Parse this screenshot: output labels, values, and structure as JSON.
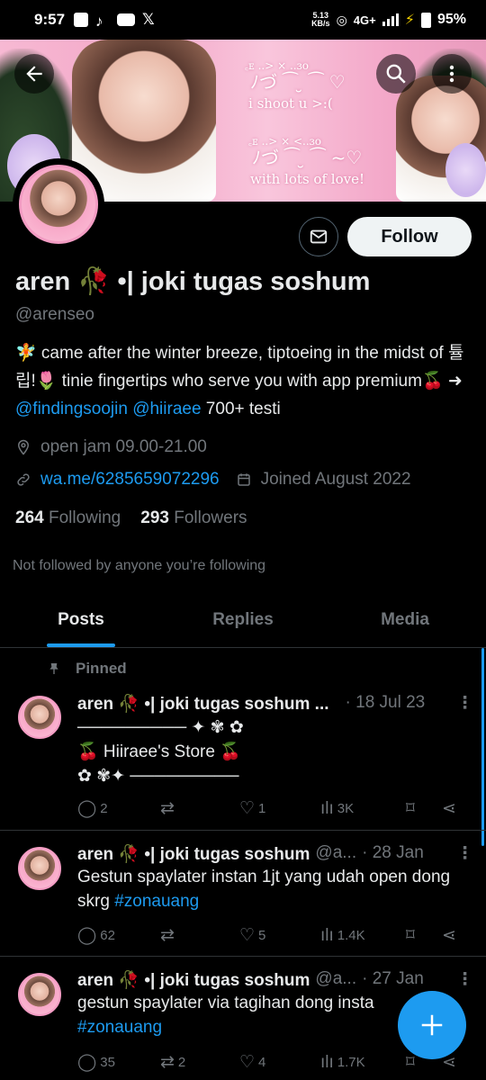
{
  "status_bar": {
    "time": "9:57",
    "speed_top": "5.13",
    "speed_bottom": "KB/s",
    "network": "4G+",
    "battery": "95%"
  },
  "banner": {
    "line1": "꜀ᴇ ..> × ..ɜo",
    "line2": "ﾉづ ⁀ ̮ ⁀ ♡",
    "line3": "i shoot u >:(",
    "line4": "꜀ᴇ ..> × <..ɜo",
    "line5": "ﾉづ ⁀ ̮ ⁀ ~♡",
    "line6": "with lots of love!"
  },
  "profile": {
    "name": "aren 🥀 •| joki tugas soshum",
    "handle": "@arenseo",
    "bio_part1": "🧚 came after the winter breeze, tiptoeing in the midst of 튤립!🌷 tinie fingertips who serve you with app premium🍒 ➜ ",
    "bio_mention1": "@findingsoojin",
    "bio_mention2": "@hiiraee",
    "bio_part2": " 700+ testi",
    "location": "open jam 09.00-21.00",
    "website": "wa.me/6285659072296",
    "joined": "Joined August 2022",
    "following_count": "264",
    "following_label": "Following",
    "followers_count": "293",
    "followers_label": "Followers",
    "not_followed": "Not followed by anyone you’re following",
    "follow_label": "Follow"
  },
  "tabs": [
    "Posts",
    "Replies",
    "Media"
  ],
  "pinned_label": "Pinned",
  "posts": [
    {
      "name": "aren 🥀 •| joki tugas soshum ...",
      "handle": "",
      "date": "· 18 Jul 23",
      "body": "───────── ✦ ✾ ✿\n🍒 Hiiraee's Store 🍒\n✿ ✾✦ ─────────",
      "hashtag": "",
      "replies": "2",
      "retweets": "",
      "likes": "1",
      "views": "3K"
    },
    {
      "name": "aren 🥀 •| joki tugas soshum",
      "handle": "@a...",
      "date": "· 28 Jan",
      "body": "Gestun spaylater instan 1jt yang udah open dong skrg ",
      "hashtag": "#zonauang",
      "replies": "62",
      "retweets": "",
      "likes": "5",
      "views": "1.4K"
    },
    {
      "name": "aren 🥀 •| joki tugas soshum",
      "handle": "@a...",
      "date": "· 27 Jan",
      "body": "gestun spaylater via tagihan dong insta",
      "hashtag": "#zonauang",
      "replies": "35",
      "retweets": "2",
      "likes": "4",
      "views": "1.7K"
    }
  ],
  "icons": {
    "back": "arrow-left-icon",
    "search": "search-icon",
    "more": "more-vertical-icon",
    "mail": "mail-icon",
    "location": "location-pin-icon",
    "link": "link-icon",
    "calendar": "calendar-icon",
    "pin": "pin-icon",
    "reply": "reply-icon",
    "retweet": "retweet-icon",
    "like": "heart-icon",
    "views": "views-icon",
    "bookmark": "bookmark-icon",
    "share": "share-icon",
    "compose": "plus-icon"
  },
  "colors": {
    "accent": "#1d9bf0",
    "background": "#000000",
    "muted": "#71767b"
  }
}
